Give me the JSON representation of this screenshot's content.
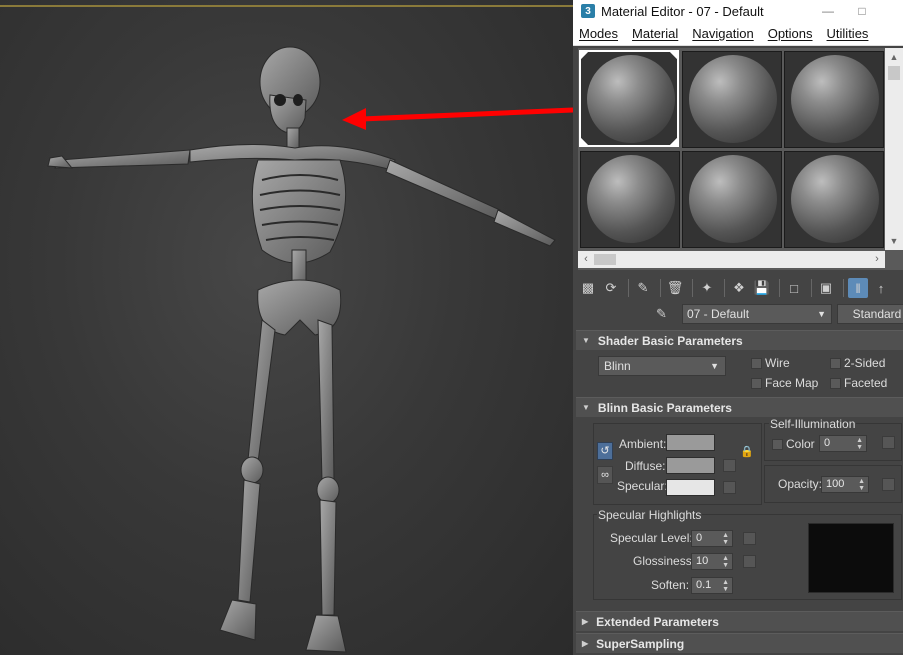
{
  "window": {
    "title": "Material Editor - 07 - Default",
    "app_badge": "3"
  },
  "menu": [
    "Modes",
    "Material",
    "Navigation",
    "Options",
    "Utilities"
  ],
  "material_row": {
    "name": "07 - Default",
    "type": "Standard"
  },
  "shader_basic": {
    "title": "Shader Basic Parameters",
    "shader": "Blinn",
    "wire": "Wire",
    "two_sided": "2-Sided",
    "face_map": "Face Map",
    "faceted": "Faceted"
  },
  "blinn_basic": {
    "title": "Blinn Basic Parameters",
    "self_illum_title": "Self-Illumination",
    "color_label": "Color",
    "color_value": "0",
    "ambient_label": "Ambient:",
    "diffuse_label": "Diffuse:",
    "specular_label": "Specular:",
    "opacity_label": "Opacity:",
    "opacity_value": "100",
    "spec_highlights_title": "Specular Highlights",
    "spec_level_label": "Specular Level:",
    "spec_level_value": "0",
    "glossiness_label": "Glossiness:",
    "glossiness_value": "10",
    "soften_label": "Soften:",
    "soften_value": "0.1",
    "colors": {
      "ambient": "#9a9a9a",
      "diffuse": "#9a9a9a",
      "specular": "#e6e6e6"
    }
  },
  "extended": {
    "title": "Extended Parameters"
  },
  "supersampling": {
    "title": "SuperSampling"
  },
  "annotation": {
    "arrow_color": "#ff0000"
  }
}
